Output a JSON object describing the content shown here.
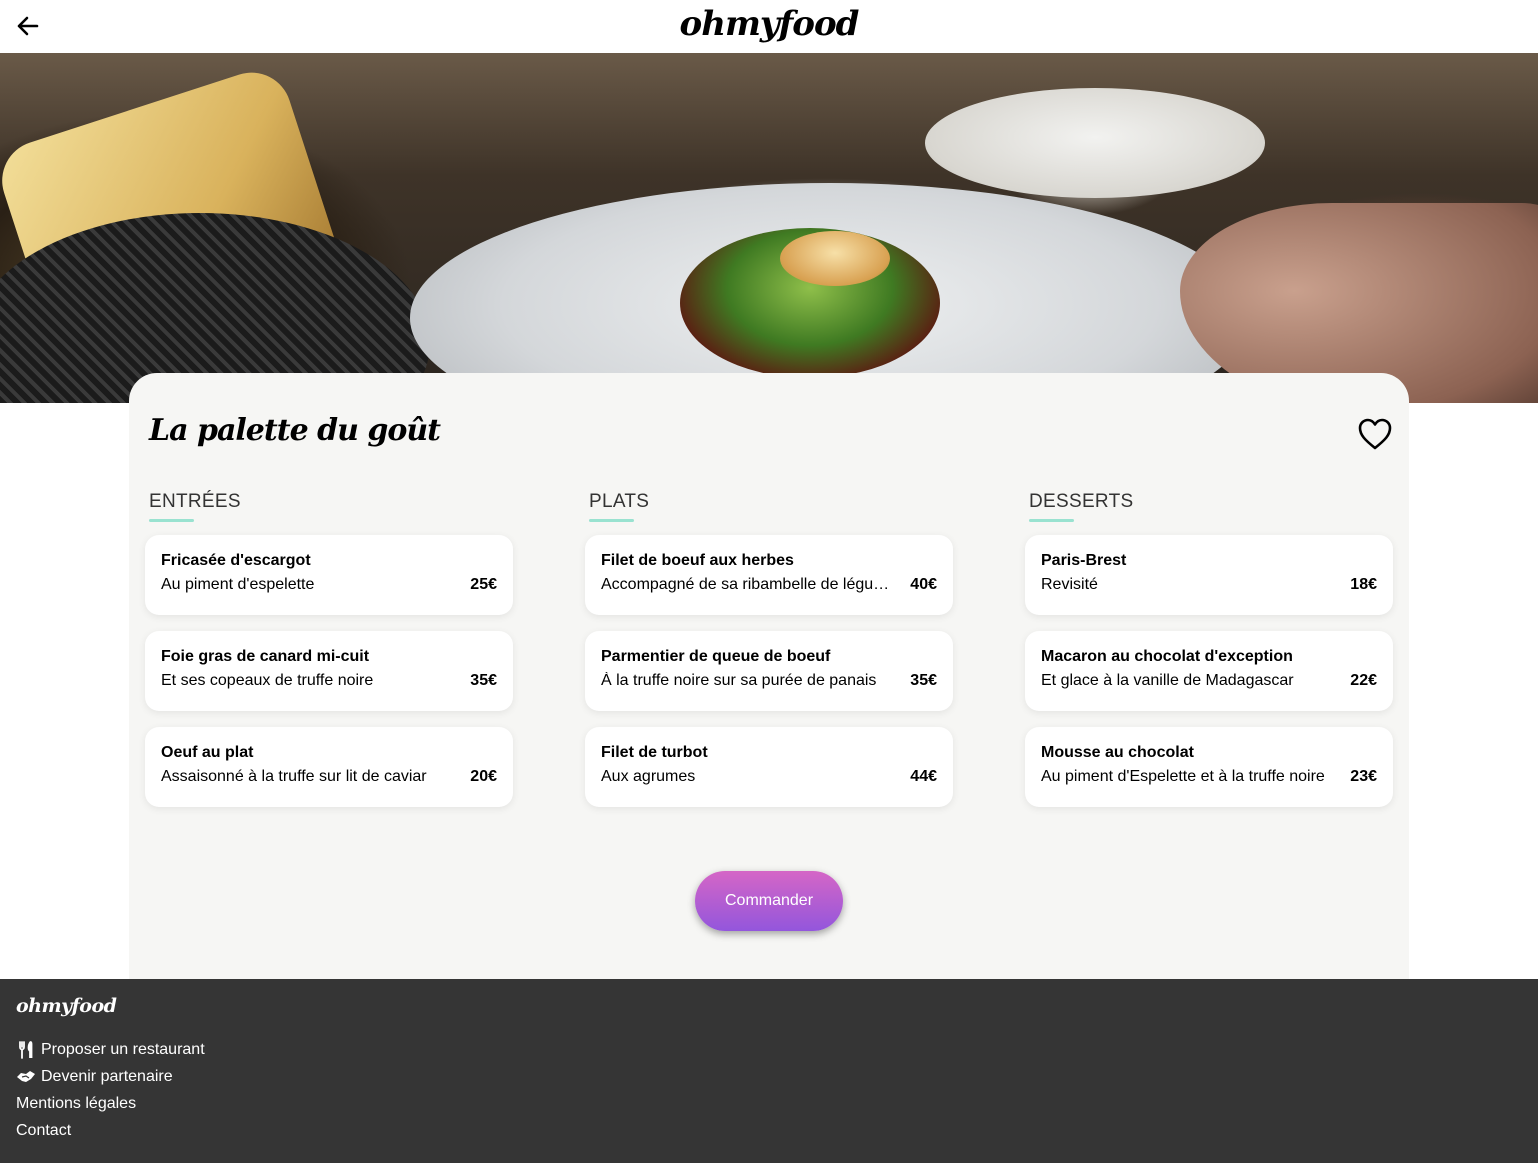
{
  "header": {
    "logo": "ohmyfood",
    "back_icon": "arrow-left-icon"
  },
  "restaurant": {
    "name": "La palette du goût",
    "favorite_icon": "heart-outline-icon"
  },
  "menu": {
    "columns": [
      {
        "title": "ENTRÉES",
        "dishes": [
          {
            "name": "Fricasée d'escargot",
            "desc": "Au piment d'espelette",
            "price": "25€"
          },
          {
            "name": "Foie gras de canard mi-cuit",
            "desc": "Et ses copeaux de truffe noire",
            "price": "35€"
          },
          {
            "name": "Oeuf au plat",
            "desc": "Assaisonné à la truffe sur lit de caviar",
            "price": "20€"
          }
        ]
      },
      {
        "title": "PLATS",
        "dishes": [
          {
            "name": "Filet de boeuf aux herbes",
            "desc": "Accompagné de sa ribambelle de légumes",
            "price": "40€"
          },
          {
            "name": "Parmentier de queue de boeuf",
            "desc": "À la truffe noire sur sa purée de panais",
            "price": "35€"
          },
          {
            "name": "Filet de turbot",
            "desc": "Aux agrumes",
            "price": "44€"
          }
        ]
      },
      {
        "title": "DESSERTS",
        "dishes": [
          {
            "name": "Paris-Brest",
            "desc": "Revisité",
            "price": "18€"
          },
          {
            "name": "Macaron au chocolat d'exception",
            "desc": "Et glace à la vanille de Madagascar",
            "price": "22€"
          },
          {
            "name": "Mousse au chocolat",
            "desc": "Au piment d'Espelette et à la truffe noire",
            "price": "23€"
          }
        ]
      }
    ]
  },
  "order_button": "Commander",
  "footer": {
    "logo": "ohmyfood",
    "links": [
      {
        "label": "Proposer un restaurant",
        "icon": "utensils-icon"
      },
      {
        "label": "Devenir partenaire",
        "icon": "handshake-icon"
      },
      {
        "label": "Mentions légales"
      },
      {
        "label": "Contact"
      }
    ]
  },
  "colors": {
    "accent_underline": "#99e2d0",
    "button_gradient_top": "#d566c6",
    "button_gradient_bottom": "#9356dc",
    "footer_bg": "#353535",
    "card_bg": "#f6f6f4"
  }
}
